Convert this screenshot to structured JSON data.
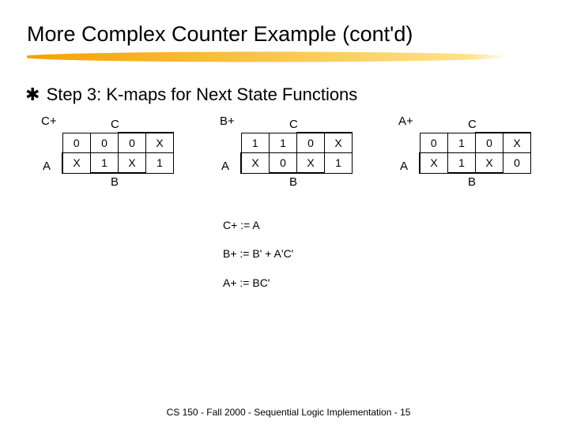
{
  "title": "More Complex Counter Example (cont'd)",
  "bullet": "Step 3: K-maps for Next State Functions",
  "kmaps": [
    {
      "owner": "C+",
      "top": "C",
      "left": "A",
      "bottom": "B",
      "cells": [
        [
          "0",
          "0",
          "0",
          "X"
        ],
        [
          "X",
          "1",
          "X",
          "1"
        ]
      ]
    },
    {
      "owner": "B+",
      "top": "C",
      "left": "A",
      "bottom": "B",
      "cells": [
        [
          "1",
          "1",
          "0",
          "X"
        ],
        [
          "X",
          "0",
          "X",
          "1"
        ]
      ]
    },
    {
      "owner": "A+",
      "top": "C",
      "left": "A",
      "bottom": "B",
      "cells": [
        [
          "0",
          "1",
          "0",
          "X"
        ],
        [
          "X",
          "1",
          "X",
          "0"
        ]
      ]
    }
  ],
  "equations": {
    "c": "C+ := A",
    "b": "B+ := B' + A'C'",
    "a": "A+ := BC'"
  },
  "footer": "CS 150 - Fall 2000 - Sequential Logic Implementation - 15"
}
